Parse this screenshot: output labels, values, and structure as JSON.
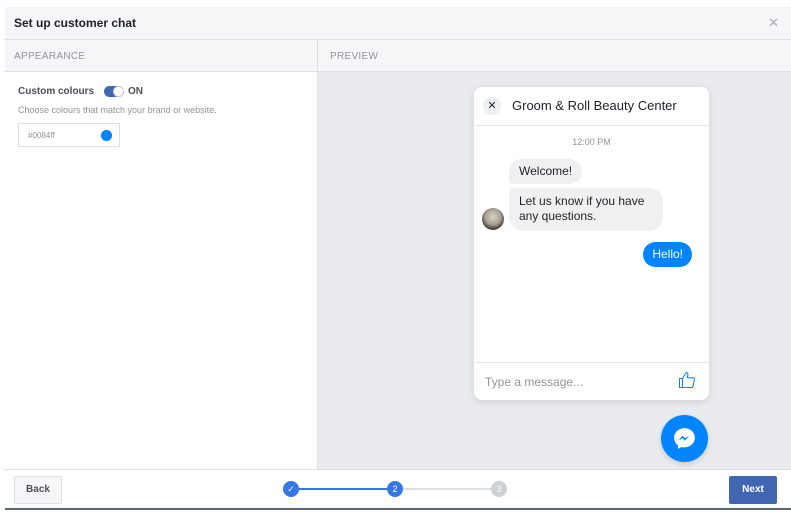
{
  "dialog": {
    "title": "Set up customer chat",
    "close_icon": "close-icon"
  },
  "columns": {
    "left": "APPEARANCE",
    "right": "PREVIEW"
  },
  "appearance": {
    "custom_colours_label": "Custom colours",
    "toggle_state": "ON",
    "description": "Choose colours that match your brand or website.",
    "color_value": "#0084ff",
    "color_swatch": "#0084ff"
  },
  "preview": {
    "chat_title": "Groom & Roll Beauty Center",
    "time": "12:00 PM",
    "messages": [
      {
        "from": "page",
        "text": "Welcome!"
      },
      {
        "from": "page",
        "text": "Let us know if you have any questions."
      },
      {
        "from": "user",
        "text": "Hello!"
      }
    ],
    "input_placeholder": "Type a message...",
    "like_icon": "thumbs-up-icon",
    "launcher_icon": "messenger-icon",
    "accent": "#0084ff"
  },
  "footer": {
    "back_label": "Back",
    "next_label": "Next",
    "steps": [
      {
        "label": "✓",
        "state": "complete"
      },
      {
        "label": "2",
        "state": "current"
      },
      {
        "label": "3",
        "state": "upcoming"
      }
    ]
  }
}
